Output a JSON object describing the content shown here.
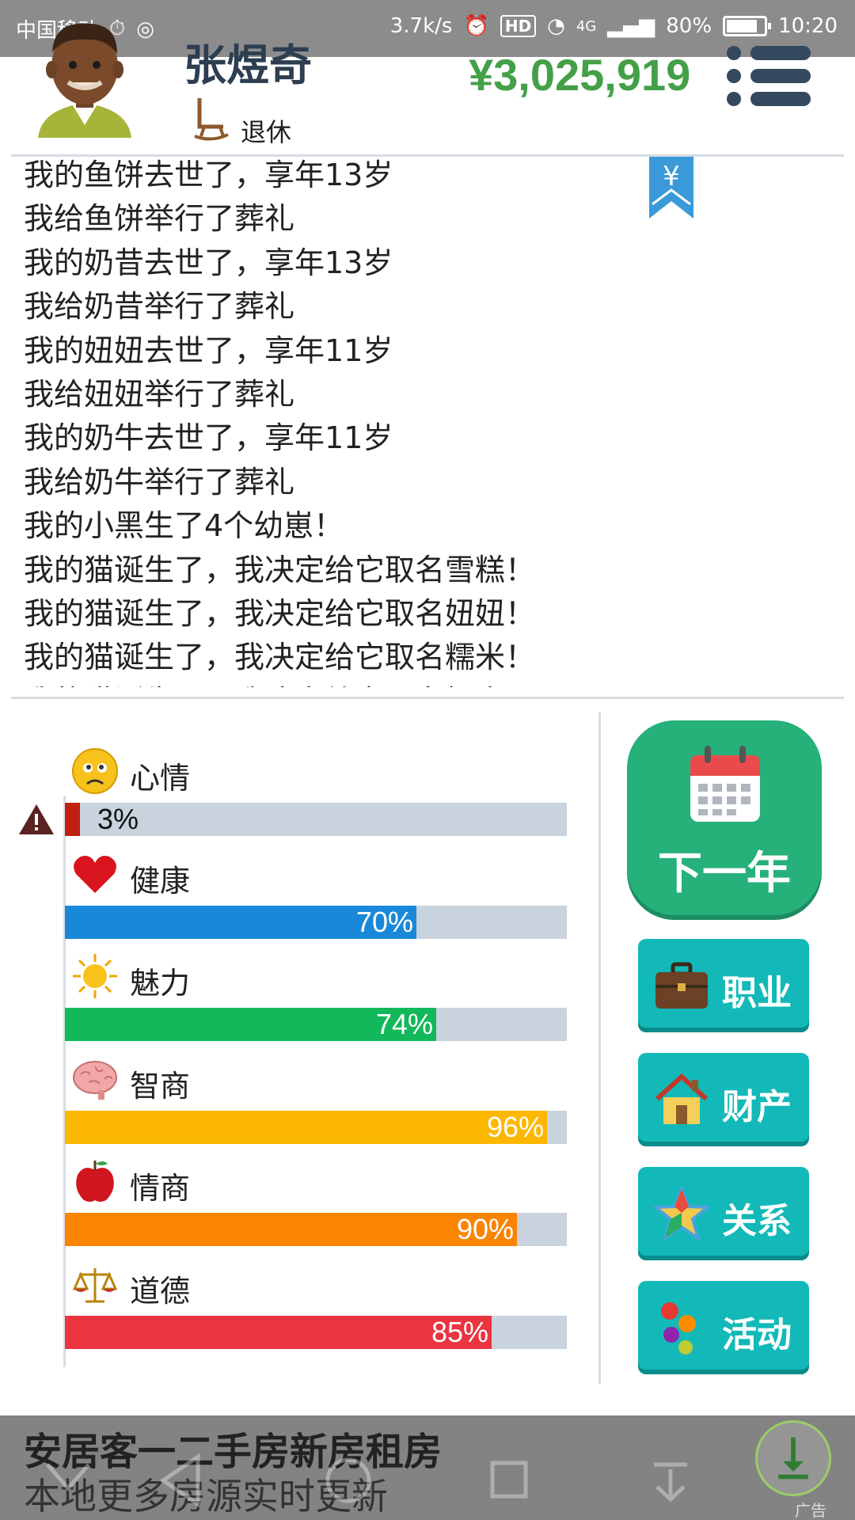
{
  "status_bar": {
    "carrier": "中国移动",
    "net_speed": "3.7k/s",
    "hd": "HD",
    "signal": "4G",
    "battery": "80%",
    "time": "10:20"
  },
  "header": {
    "name": "张煜奇",
    "status": "退休",
    "money": "¥3,025,919"
  },
  "log": [
    "我的鱼饼去世了，享年13岁",
    "我给鱼饼举行了葬礼",
    "我的奶昔去世了，享年13岁",
    "我给奶昔举行了葬礼",
    "我的妞妞去世了，享年11岁",
    "我给妞妞举行了葬礼",
    "我的奶牛去世了，享年11岁",
    "我给奶牛举行了葬礼",
    "我的小黑生了4个幼崽！",
    "我的猫诞生了，我决定给它取名雪糕！",
    "我的猫诞生了，我决定给它取名妞妞！",
    "我的猫诞生了，我决定给它取名糯米！"
  ],
  "bookmark_symbol": "¥",
  "stats": [
    {
      "label": "心情",
      "value_text": "3%",
      "fraction": 0.03,
      "color": "#c0200f",
      "icon": "sad-face-icon",
      "warning": true
    },
    {
      "label": "健康",
      "value_text": "70%",
      "fraction": 0.7,
      "color": "#1a88d8",
      "icon": "heart-icon",
      "warning": false
    },
    {
      "label": "魅力",
      "value_text": "74%",
      "fraction": 0.74,
      "color": "#12b85a",
      "icon": "sun-icon",
      "warning": false
    },
    {
      "label": "智商",
      "value_text": "96%",
      "fraction": 0.96,
      "color": "#fcb800",
      "icon": "brain-icon",
      "warning": false
    },
    {
      "label": "情商",
      "value_text": "90%",
      "fraction": 0.9,
      "color": "#fb8400",
      "icon": "apple-icon",
      "warning": false
    },
    {
      "label": "道德",
      "value_text": "85%",
      "fraction": 0.85,
      "color": "#ea3440",
      "icon": "scales-icon",
      "warning": false
    }
  ],
  "buttons": {
    "next_year": "下一年",
    "career": "职业",
    "assets": "财产",
    "relations": "关系",
    "activities": "活动"
  },
  "ad": {
    "title": "安居客一二手房新房租房",
    "subtitle": "本地更多房源实时更新",
    "tag": "广告"
  }
}
